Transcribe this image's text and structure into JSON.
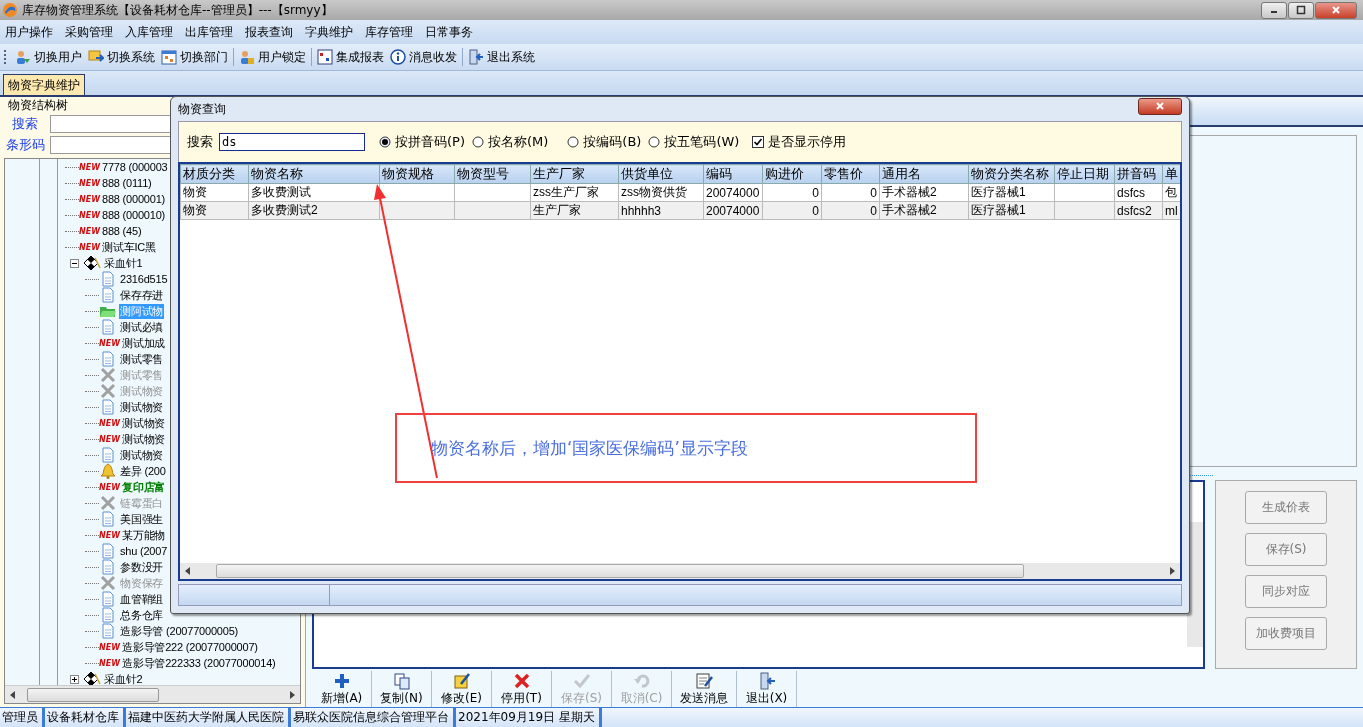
{
  "window": {
    "title": "库存物资管理系统【设备耗材仓库--管理员】---【srmyy】"
  },
  "menu": [
    "用户操作",
    "采购管理",
    "入库管理",
    "出库管理",
    "报表查询",
    "字典维护",
    "库存管理",
    "日常事务"
  ],
  "toolbar": [
    {
      "label": "切换用户",
      "kind": "users"
    },
    {
      "label": "切换系统",
      "kind": "switch"
    },
    {
      "label": "切换部门",
      "kind": "calendar"
    },
    {
      "label": "用户锁定",
      "kind": "lock"
    },
    {
      "label": "集成报表",
      "kind": "report"
    },
    {
      "label": "消息收发",
      "kind": "info"
    },
    {
      "label": "退出系统",
      "kind": "exit"
    }
  ],
  "tabs": [
    {
      "label": "物资字典维护",
      "selected": true
    }
  ],
  "tree": {
    "title": "物资结构树",
    "search_label": "搜索",
    "barcode_label": "条形码",
    "items": [
      {
        "label": "7778 (000003",
        "badge": "NEW",
        "selected": false,
        "disabled": false
      },
      {
        "label": "888 (0111)",
        "badge": "NEW",
        "selected": false,
        "disabled": false
      },
      {
        "label": "888 (000001)",
        "badge": "NEW",
        "selected": false,
        "disabled": false
      },
      {
        "label": "888 (000010)",
        "badge": "NEW",
        "selected": false,
        "disabled": false
      },
      {
        "label": "888 (45)",
        "badge": "NEW",
        "selected": false,
        "disabled": false
      },
      {
        "label": "测试车IC黑",
        "badge": "NEW",
        "selected": false,
        "disabled": false
      },
      {
        "label": "采血针1",
        "kind": "needle",
        "selected": false,
        "disabled": false,
        "expanded": true,
        "children": [
          {
            "label": "2316d515",
            "kind": "doc",
            "selected": false,
            "disabled": false
          },
          {
            "label": "保存存进",
            "kind": "doc",
            "selected": false,
            "disabled": false
          },
          {
            "label": "测阿试物",
            "kind": "folder",
            "selected": true,
            "disabled": false
          },
          {
            "label": "测试必填",
            "kind": "doc",
            "selected": false,
            "disabled": false
          },
          {
            "label": "测试加成",
            "badge": "NEW",
            "selected": false,
            "disabled": false
          },
          {
            "label": "测试零售",
            "kind": "doc",
            "selected": false,
            "disabled": false
          },
          {
            "label": "测试零售",
            "kind": "cross",
            "selected": false,
            "disabled": true
          },
          {
            "label": "测试物资",
            "kind": "cross",
            "selected": false,
            "disabled": true
          },
          {
            "label": "测试物资",
            "kind": "doc",
            "selected": false,
            "disabled": false
          },
          {
            "label": "测试物资",
            "badge": "NEW",
            "selected": false,
            "disabled": false
          },
          {
            "label": "测试物资",
            "badge": "NEW",
            "selected": false,
            "disabled": false
          },
          {
            "label": "测试物资",
            "kind": "doc",
            "selected": false,
            "disabled": false
          },
          {
            "label": "差异 (200",
            "kind": "bell",
            "selected": false,
            "disabled": false
          },
          {
            "label": "复印店富",
            "badge": "NEW",
            "selected": false,
            "disabled": false,
            "color": "#008000"
          },
          {
            "label": "链霉蛋白",
            "kind": "cross",
            "selected": false,
            "disabled": true
          },
          {
            "label": "美国强生",
            "kind": "doc",
            "selected": false,
            "disabled": false
          },
          {
            "label": "某万能物",
            "badge": "NEW",
            "selected": false,
            "disabled": false
          },
          {
            "label": "shu (2007",
            "kind": "doc",
            "selected": false,
            "disabled": false
          },
          {
            "label": "参数没开",
            "kind": "doc",
            "selected": false,
            "disabled": false
          },
          {
            "label": "物资保存",
            "kind": "cross",
            "selected": false,
            "disabled": true
          },
          {
            "label": "血管鞘组",
            "kind": "doc",
            "selected": false,
            "disabled": false
          },
          {
            "label": "总务仓库",
            "kind": "doc",
            "selected": false,
            "disabled": false
          },
          {
            "label": "造影导管 (20077000005)",
            "kind": "doc",
            "selected": false,
            "disabled": false
          },
          {
            "label": "造影导管222 (20077000007)",
            "badge": "NEW",
            "selected": false,
            "disabled": false
          },
          {
            "label": "造影导管222333 (20077000014)",
            "badge": "NEW",
            "selected": false,
            "disabled": false
          }
        ]
      },
      {
        "label": "采血针2",
        "kind": "needle",
        "selected": false,
        "disabled": false,
        "expanded": false
      }
    ]
  },
  "side_buttons": [
    {
      "label": "生成价表",
      "disabled": true
    },
    {
      "label": "保存(S)",
      "disabled": true
    },
    {
      "label": "同步对应",
      "disabled": true
    },
    {
      "label": "加收费项目",
      "disabled": true
    }
  ],
  "bottom_toolbar": [
    {
      "label": "新增(A)",
      "kind": "plus",
      "disabled": false
    },
    {
      "label": "复制(N)",
      "kind": "copy",
      "disabled": false
    },
    {
      "label": "修改(E)",
      "kind": "edit",
      "disabled": false
    },
    {
      "label": "停用(T)",
      "kind": "stop",
      "disabled": false
    },
    {
      "label": "保存(S)",
      "kind": "check",
      "disabled": true
    },
    {
      "label": "取消(C)",
      "kind": "undo",
      "disabled": true
    },
    {
      "label": "发送消息",
      "kind": "message",
      "disabled": false
    },
    {
      "label": "退出(X)",
      "kind": "exit",
      "disabled": false
    }
  ],
  "status_bar": [
    "管理员",
    "设备耗材仓库",
    "福建中医药大学附属人民医院",
    "易联众医院信息综合管理平台",
    "2021年09月19日 星期天"
  ],
  "dialog": {
    "title": "物资查询",
    "search_label": "搜索",
    "search_value": "ds",
    "radios": [
      {
        "label": "按拼音码(P)",
        "selected": true
      },
      {
        "label": "按名称(M)",
        "selected": false
      },
      {
        "label": "按编码(B)",
        "selected": false
      },
      {
        "label": "按五笔码(W)",
        "selected": false
      }
    ],
    "show_disabled": {
      "label": "是否显示停用",
      "checked": true
    },
    "columns": [
      "材质分类",
      "物资名称",
      "物资规格",
      "物资型号",
      "生产厂家",
      "供货单位",
      "编码",
      "购进价",
      "零售价",
      "通用名",
      "物资分类名称",
      "停止日期",
      "拼音码",
      "单"
    ],
    "rows": [
      [
        "物资",
        "多收费测试",
        "",
        "",
        "zss生产厂家",
        "zss物资供货",
        "20074000",
        "0",
        "0",
        "手术器械2",
        "医疗器械1",
        "",
        "dsfcs",
        "包"
      ],
      [
        "物资",
        "多收费测试2",
        "",
        "",
        "生产厂家",
        "hhhhh3",
        "20074000",
        "0",
        "0",
        "手术器械2",
        "医疗器械1",
        "",
        "dsfcs2",
        "ml"
      ]
    ]
  },
  "annotation": {
    "text": "物资名称后，增加‘国家医保编码’显示字段"
  }
}
